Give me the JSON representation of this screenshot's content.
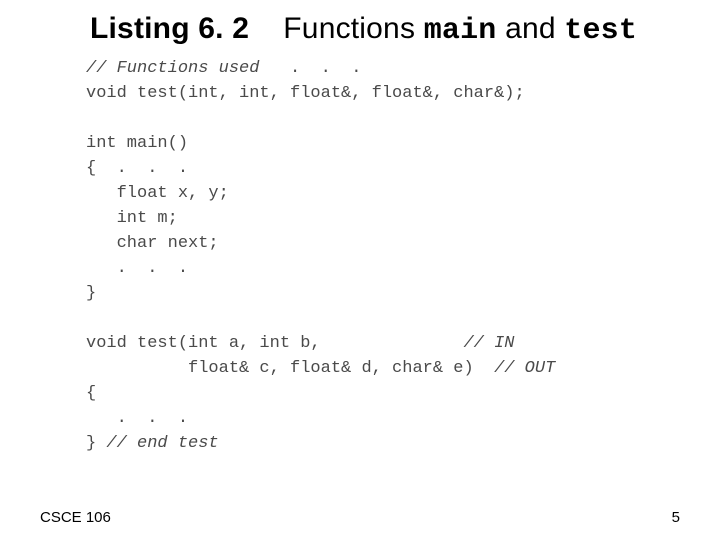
{
  "title": {
    "listing_label": "Listing 6. 2",
    "functions_word": "Functions",
    "name_main": "main",
    "and_word": "and",
    "name_test": "test"
  },
  "code_lines": {
    "l1_comment": "// Functions used ",
    "l1_dots": "  .  .  .",
    "l2": "void test(int, int, float&, float&, char&);",
    "l3": "",
    "l4": "int main()",
    "l5": "{  .  .  .",
    "l6": "   float x, y;",
    "l7": "   int m;",
    "l8": "   char next;",
    "l9": "   .  .  .",
    "l10": "}",
    "l11": "",
    "l12_sig": "void test(int a, int b,              ",
    "l12_cm": "// IN",
    "l13_sig": "          float& c, float& d, char& e)  ",
    "l13_cm": "// OUT",
    "l14": "{",
    "l15": "   .  .  .",
    "l16_brace": "} ",
    "l16_cm": "// end test"
  },
  "footer": {
    "course": "CSCE 106",
    "page_number": "5"
  }
}
